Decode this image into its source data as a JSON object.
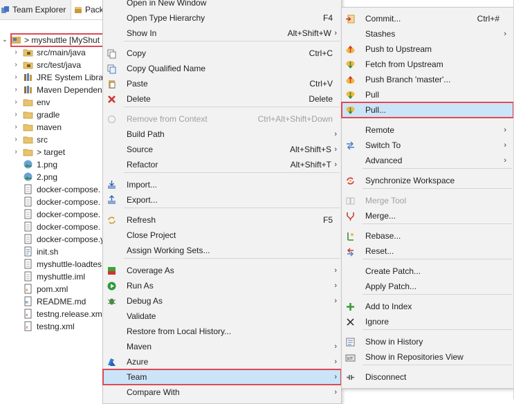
{
  "tabs": [
    {
      "label": "Team Explorer"
    },
    {
      "label": "Pack"
    }
  ],
  "tree": {
    "root": {
      "label": "> myshuttle [MyShut"
    },
    "items": [
      {
        "label": "src/main/java",
        "icon": "package-folder-icon"
      },
      {
        "label": "src/test/java",
        "icon": "package-folder-icon"
      },
      {
        "label": "JRE System Library",
        "icon": "library-icon"
      },
      {
        "label": "Maven Dependencies",
        "icon": "library-icon"
      },
      {
        "label": "env",
        "icon": "folder-icon"
      },
      {
        "label": "gradle",
        "icon": "folder-icon"
      },
      {
        "label": "maven",
        "icon": "folder-icon"
      },
      {
        "label": "src",
        "icon": "folder-icon"
      },
      {
        "label": "> target",
        "icon": "folder-icon"
      },
      {
        "label": "1.png",
        "icon": "image-icon"
      },
      {
        "label": "2.png",
        "icon": "image-icon"
      },
      {
        "label": "docker-compose.",
        "icon": "file-icon"
      },
      {
        "label": "docker-compose.",
        "icon": "file-icon"
      },
      {
        "label": "docker-compose.",
        "icon": "file-icon"
      },
      {
        "label": "docker-compose.",
        "icon": "file-icon"
      },
      {
        "label": "docker-compose.y",
        "icon": "file-icon"
      },
      {
        "label": "init.sh",
        "icon": "script-icon"
      },
      {
        "label": "myshuttle-loadtes",
        "icon": "file-icon"
      },
      {
        "label": "myshuttle.iml",
        "icon": "file-icon"
      },
      {
        "label": "pom.xml",
        "icon": "xml-file-icon"
      },
      {
        "label": "README.md",
        "icon": "markdown-file-icon"
      },
      {
        "label": "testng.release.xml",
        "icon": "xml-file-icon"
      },
      {
        "label": "testng.xml",
        "icon": "xml-file-icon"
      }
    ]
  },
  "context_menu": {
    "items": [
      {
        "label": "Open in New Window",
        "shortcut": "",
        "arrow": false
      },
      {
        "label": "Open Type Hierarchy",
        "shortcut": "F4",
        "arrow": false
      },
      {
        "label": "Show In",
        "shortcut": "Alt+Shift+W",
        "arrow": true
      },
      {
        "label": "Copy",
        "shortcut": "Ctrl+C",
        "arrow": false
      },
      {
        "label": "Copy Qualified Name",
        "shortcut": "",
        "arrow": false
      },
      {
        "label": "Paste",
        "shortcut": "Ctrl+V",
        "arrow": false
      },
      {
        "label": "Delete",
        "shortcut": "Delete",
        "arrow": false
      },
      {
        "label": "Remove from Context",
        "shortcut": "Ctrl+Alt+Shift+Down",
        "arrow": false
      },
      {
        "label": "Build Path",
        "shortcut": "",
        "arrow": true
      },
      {
        "label": "Source",
        "shortcut": "Alt+Shift+S",
        "arrow": true
      },
      {
        "label": "Refactor",
        "shortcut": "Alt+Shift+T",
        "arrow": true
      },
      {
        "label": "Import...",
        "shortcut": "",
        "arrow": false
      },
      {
        "label": "Export...",
        "shortcut": "",
        "arrow": false
      },
      {
        "label": "Refresh",
        "shortcut": "F5",
        "arrow": false
      },
      {
        "label": "Close Project",
        "shortcut": "",
        "arrow": false
      },
      {
        "label": "Assign Working Sets...",
        "shortcut": "",
        "arrow": false
      },
      {
        "label": "Coverage As",
        "shortcut": "",
        "arrow": true
      },
      {
        "label": "Run As",
        "shortcut": "",
        "arrow": true
      },
      {
        "label": "Debug As",
        "shortcut": "",
        "arrow": true
      },
      {
        "label": "Validate",
        "shortcut": "",
        "arrow": false
      },
      {
        "label": "Restore from Local History...",
        "shortcut": "",
        "arrow": false
      },
      {
        "label": "Maven",
        "shortcut": "",
        "arrow": true
      },
      {
        "label": "Azure",
        "shortcut": "",
        "arrow": true
      },
      {
        "label": "Team",
        "shortcut": "",
        "arrow": true
      },
      {
        "label": "Compare With",
        "shortcut": "",
        "arrow": true
      }
    ]
  },
  "team_menu": {
    "items": [
      {
        "label": "Commit...",
        "shortcut": "Ctrl+#",
        "arrow": false
      },
      {
        "label": "Stashes",
        "shortcut": "",
        "arrow": true
      },
      {
        "label": "Push to Upstream",
        "shortcut": "",
        "arrow": false
      },
      {
        "label": "Fetch from Upstream",
        "shortcut": "",
        "arrow": false
      },
      {
        "label": "Push Branch 'master'...",
        "shortcut": "",
        "arrow": false
      },
      {
        "label": "Pull",
        "shortcut": "",
        "arrow": false
      },
      {
        "label": "Pull...",
        "shortcut": "",
        "arrow": false
      },
      {
        "label": "Remote",
        "shortcut": "",
        "arrow": true
      },
      {
        "label": "Switch To",
        "shortcut": "",
        "arrow": true
      },
      {
        "label": "Advanced",
        "shortcut": "",
        "arrow": true
      },
      {
        "label": "Synchronize Workspace",
        "shortcut": "",
        "arrow": false
      },
      {
        "label": "Merge Tool",
        "shortcut": "",
        "arrow": false
      },
      {
        "label": "Merge...",
        "shortcut": "",
        "arrow": false
      },
      {
        "label": "Rebase...",
        "shortcut": "",
        "arrow": false
      },
      {
        "label": "Reset...",
        "shortcut": "",
        "arrow": false
      },
      {
        "label": "Create Patch...",
        "shortcut": "",
        "arrow": false
      },
      {
        "label": "Apply Patch...",
        "shortcut": "",
        "arrow": false
      },
      {
        "label": "Add to Index",
        "shortcut": "",
        "arrow": false
      },
      {
        "label": "Ignore",
        "shortcut": "",
        "arrow": false
      },
      {
        "label": "Show in History",
        "shortcut": "",
        "arrow": false
      },
      {
        "label": "Show in Repositories View",
        "shortcut": "",
        "arrow": false
      },
      {
        "label": "Disconnect",
        "shortcut": "",
        "arrow": false
      }
    ]
  },
  "colors": {
    "highlight": "#cce4f7",
    "callout": "#e04855",
    "menu_bg": "#f2f2f2"
  }
}
